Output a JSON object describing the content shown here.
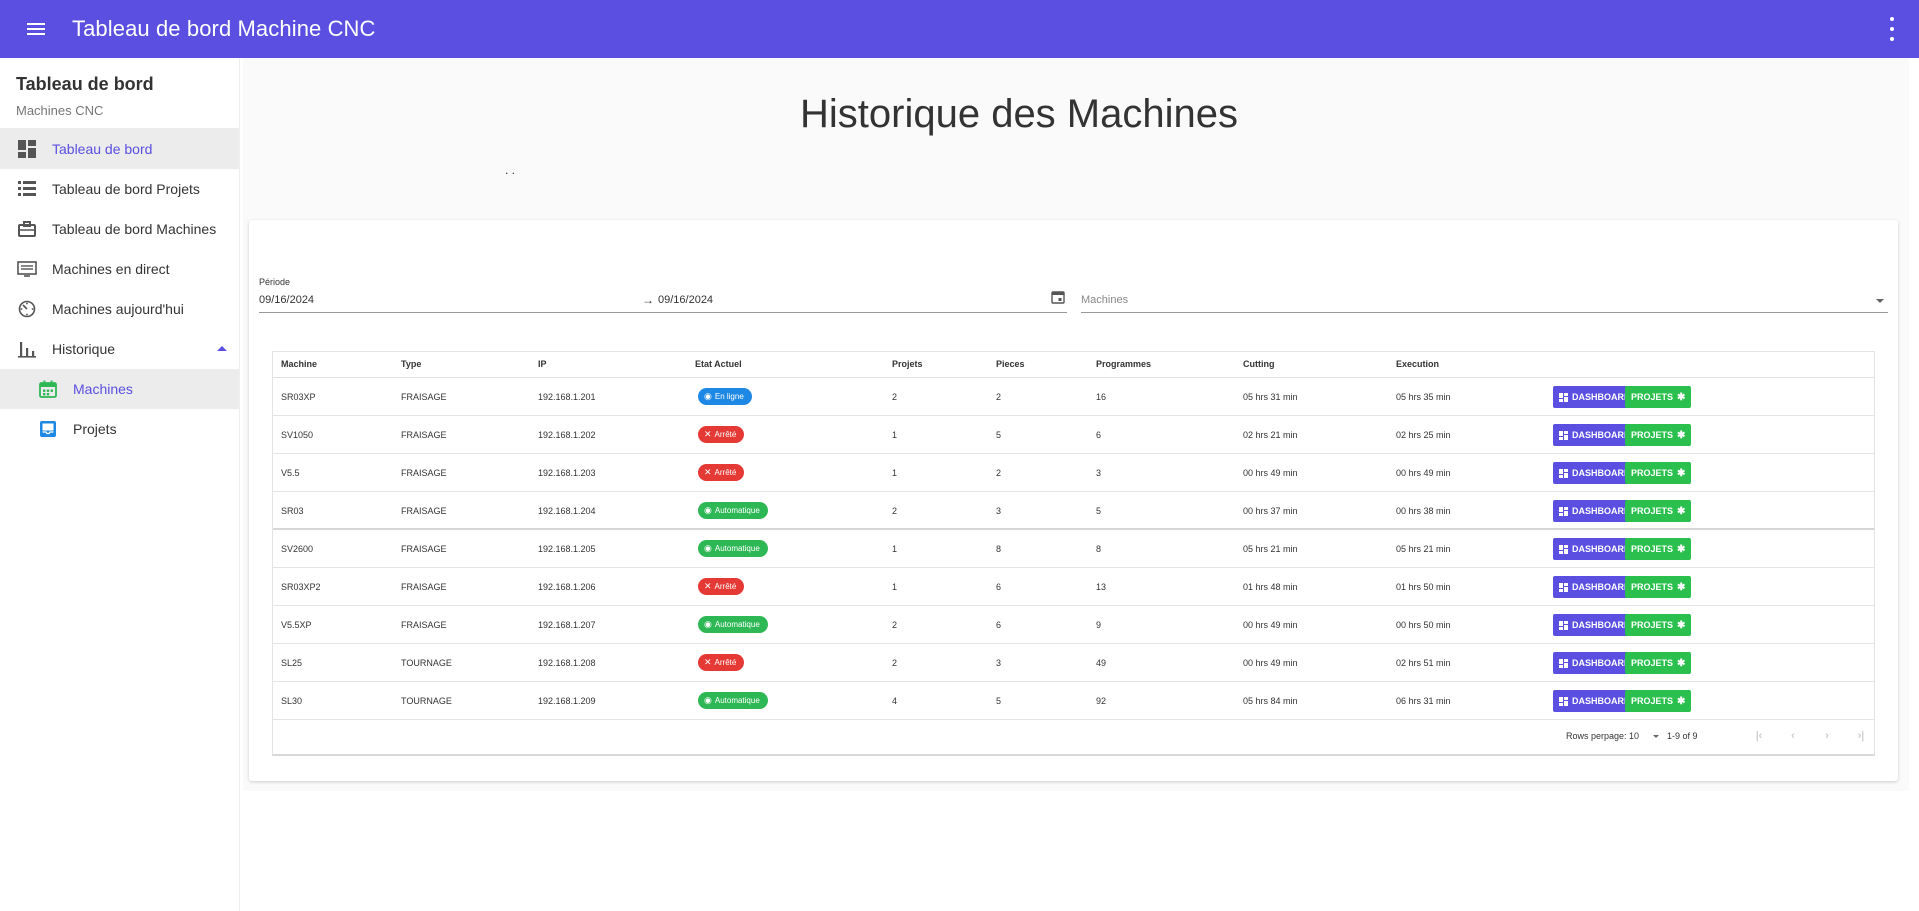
{
  "appbar": {
    "title": "Tableau de bord Machine CNC"
  },
  "sidebar": {
    "title": "Tableau de bord",
    "subtitle": "Machines CNC",
    "items": [
      {
        "label": "Tableau de bord",
        "icon": "dashboard-icon"
      },
      {
        "label": "Tableau de bord Projets",
        "icon": "list-icon"
      },
      {
        "label": "Tableau de bord Machines",
        "icon": "briefcase-icon"
      },
      {
        "label": "Machines en direct",
        "icon": "monitor-icon"
      },
      {
        "label": "Machines aujourd'hui",
        "icon": "timer-icon"
      },
      {
        "label": "Historique",
        "icon": "bar-chart-icon"
      },
      {
        "label": "Machines",
        "icon": "calendar-icon"
      },
      {
        "label": "Projets",
        "icon": "inbox-icon"
      }
    ]
  },
  "page": {
    "title": "Historique des Machines",
    "dots": ". ."
  },
  "filters": {
    "period_label": "Période",
    "from": "09/16/2024",
    "arrow": "→",
    "to": "09/16/2024",
    "machines_placeholder": "Machines"
  },
  "table": {
    "headers": [
      "Machine",
      "Type",
      "IP",
      "Etat Actuel",
      "Projets",
      "Pieces",
      "Programmes",
      "Cutting",
      "Execution"
    ],
    "buttons": {
      "dashboard": "DASHBOARD",
      "projets": "PROJETS"
    },
    "rows": [
      {
        "machine": "SR03XP",
        "type": "FRAISAGE",
        "ip": "192.168.1.201",
        "etat": "En ligne",
        "etat_kind": "online",
        "projets": "2",
        "pieces": "2",
        "programmes": "16",
        "cutting": "05 hrs 31 min",
        "execution": "05 hrs 35 min"
      },
      {
        "machine": "SV1050",
        "type": "FRAISAGE",
        "ip": "192.168.1.202",
        "etat": "Arrêté",
        "etat_kind": "stop",
        "projets": "1",
        "pieces": "5",
        "programmes": "6",
        "cutting": "02 hrs 21 min",
        "execution": "02 hrs 25 min"
      },
      {
        "machine": "V5.5",
        "type": "FRAISAGE",
        "ip": "192.168.1.203",
        "etat": "Arrêté",
        "etat_kind": "stop",
        "projets": "1",
        "pieces": "2",
        "programmes": "3",
        "cutting": "00 hrs 49 min",
        "execution": "00 hrs 49 min"
      },
      {
        "machine": "SR03",
        "type": "FRAISAGE",
        "ip": "192.168.1.204",
        "etat": "Automatique",
        "etat_kind": "auto",
        "projets": "2",
        "pieces": "3",
        "programmes": "5",
        "cutting": "00 hrs 37 min",
        "execution": "00 hrs 38 min"
      },
      {
        "machine": "SV2600",
        "type": "FRAISAGE",
        "ip": "192.168.1.205",
        "etat": "Automatique",
        "etat_kind": "auto",
        "projets": "1",
        "pieces": "8",
        "programmes": "8",
        "cutting": "05 hrs 21 min",
        "execution": "05 hrs 21 min"
      },
      {
        "machine": "SR03XP2",
        "type": "FRAISAGE",
        "ip": "192.168.1.206",
        "etat": "Arrêté",
        "etat_kind": "stop",
        "projets": "1",
        "pieces": "6",
        "programmes": "13",
        "cutting": "01 hrs 48 min",
        "execution": "01 hrs 50 min"
      },
      {
        "machine": "V5.5XP",
        "type": "FRAISAGE",
        "ip": "192.168.1.207",
        "etat": "Automatique",
        "etat_kind": "auto",
        "projets": "2",
        "pieces": "6",
        "programmes": "9",
        "cutting": "00 hrs 49 min",
        "execution": "00 hrs 50 min"
      },
      {
        "machine": "SL25",
        "type": "TOURNAGE",
        "ip": "192.168.1.208",
        "etat": "Arrêté",
        "etat_kind": "stop",
        "projets": "2",
        "pieces": "3",
        "programmes": "49",
        "cutting": "00 hrs 49 min",
        "execution": "02 hrs 51 min"
      },
      {
        "machine": "SL30",
        "type": "TOURNAGE",
        "ip": "192.168.1.209",
        "etat": "Automatique",
        "etat_kind": "auto",
        "projets": "4",
        "pieces": "5",
        "programmes": "92",
        "cutting": "05 hrs 84 min",
        "execution": "06 hrs 31 min"
      }
    ]
  },
  "pager": {
    "rows_label": "Rows perpage:",
    "rows_value": "10",
    "range": "1-9 of 9"
  },
  "colors": {
    "primary": "#5a4fe0",
    "online": "#1e88e5",
    "auto": "#2eb855",
    "stop": "#e53935",
    "projets_btn": "#2bc04e"
  }
}
